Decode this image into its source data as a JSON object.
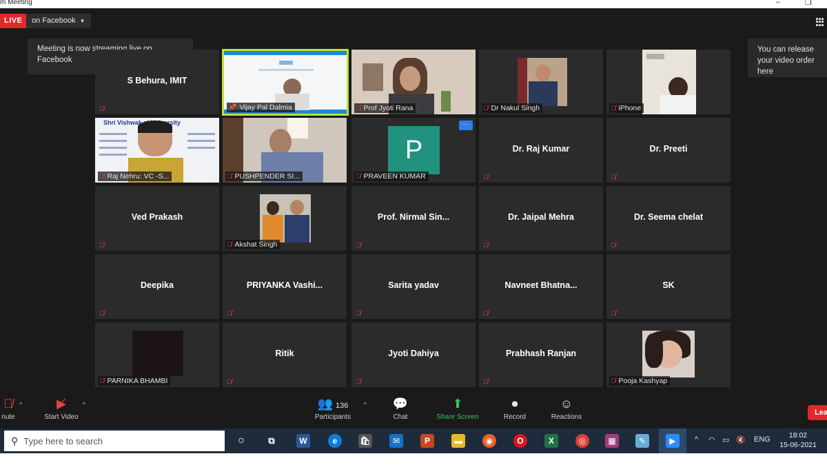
{
  "window": {
    "title": "m Meeting",
    "minimize_glyph": "–",
    "restore_glyph": "❐"
  },
  "live": {
    "badge": "LIVE",
    "destination": "on Facebook",
    "tooltip_left": "Meeting is now streaming live on Facebook",
    "tooltip_right": "You can release your video order here"
  },
  "tiles": [
    {
      "name": "S Behura, IMIT",
      "label": "",
      "video": false
    },
    {
      "name": "",
      "label": "Vijay Pal Dalmia",
      "video": true,
      "pinned": true,
      "active": true
    },
    {
      "name": "",
      "label": "Prof Jyoti Rana",
      "video": true
    },
    {
      "name": "",
      "label": "Dr Nakul Singh",
      "video": true
    },
    {
      "name": "",
      "label": "iPhone",
      "video": true
    },
    {
      "name": "",
      "label": "Raj Nehru: VC -S...",
      "video": true,
      "slide_title": "Shri Vishwak       al University"
    },
    {
      "name": "",
      "label": "PUSHPENDER SI...",
      "video": true
    },
    {
      "name": "",
      "label": "PRAVEEN KUMAR",
      "video": false,
      "avatar": "P",
      "more": "···"
    },
    {
      "name": "Dr. Raj Kumar",
      "label": "",
      "video": false
    },
    {
      "name": "Dr. Preeti",
      "label": "",
      "video": false
    },
    {
      "name": "Ved Prakash",
      "label": "",
      "video": false
    },
    {
      "name": "",
      "label": "Akshat Singh",
      "video": true
    },
    {
      "name": "Prof.  Nirmal  Sin...",
      "label": "",
      "video": false
    },
    {
      "name": "Dr. Jaipal Mehra",
      "label": "",
      "video": false
    },
    {
      "name": "Dr. Seema chelat",
      "label": "",
      "video": false
    },
    {
      "name": "Deepika",
      "label": "",
      "video": false
    },
    {
      "name": "PRIYANKA  Vashi...",
      "label": "",
      "video": false
    },
    {
      "name": "Sarita yadav",
      "label": "",
      "video": false
    },
    {
      "name": "Navneet  Bhatna...",
      "label": "",
      "video": false
    },
    {
      "name": "SK",
      "label": "",
      "video": false
    },
    {
      "name": "",
      "label": "PARNIKA BHAMBI",
      "video": true
    },
    {
      "name": "Ritik",
      "label": "",
      "video": false
    },
    {
      "name": "Jyoti Dahiya",
      "label": "",
      "video": false
    },
    {
      "name": "Prabhash Ranjan",
      "label": "",
      "video": false
    },
    {
      "name": "",
      "label": "Pooja Kashyap",
      "video": true
    }
  ],
  "toolbar": {
    "mute": "nute",
    "start_video": "Start Video",
    "participants": "Participants",
    "participants_count": "136",
    "chat": "Chat",
    "share_screen": "Share Screen",
    "record": "Record",
    "reactions": "Reactions",
    "leave": "Lea"
  },
  "taskbar": {
    "search_placeholder": "Type here to search",
    "language": "ENG",
    "time": "18:02",
    "date": "15-06-2021"
  },
  "colors": {
    "accent_green": "#33c35e",
    "active_border": "#b8e336",
    "live_red": "#e02828",
    "avatar_teal": "#21927e"
  }
}
